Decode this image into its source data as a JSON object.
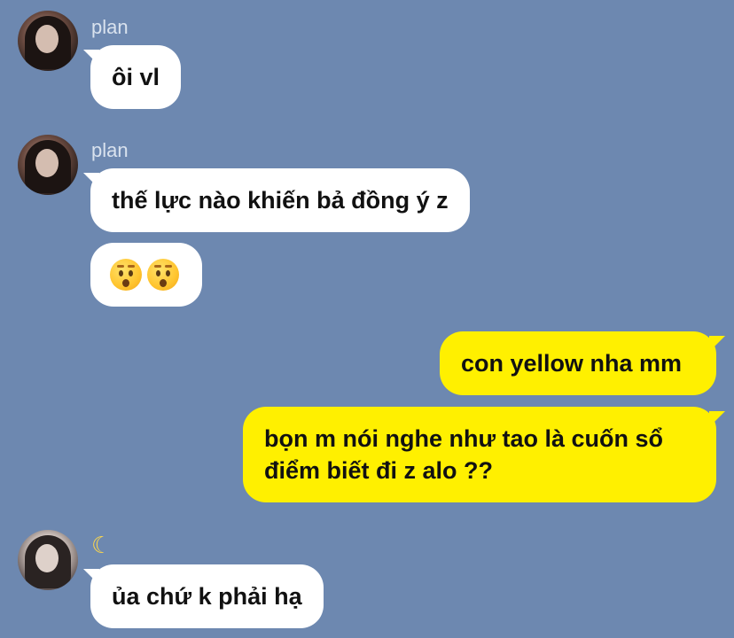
{
  "messages": [
    {
      "sender": "plan",
      "text": "ôi vl"
    },
    {
      "sender": "plan",
      "text": "thế lực nào khiến bả đồng ý z"
    },
    {
      "emoji_description": "hushed-face-emoji-x2"
    },
    {
      "sender": "me",
      "text": "con yellow nha mm"
    },
    {
      "sender": "me",
      "text_line1": "bọn m nói nghe như tao là cuốn sổ",
      "text_line2": "điểm biết đi z alo ??"
    },
    {
      "sender_icon": "crescent-moon",
      "text": "ủa chứ k phải hạ"
    }
  ],
  "colors": {
    "background": "#6d88b0",
    "incoming_bubble": "#ffffff",
    "outgoing_bubble": "#fff000",
    "sender_name": "#d9e2ee"
  }
}
